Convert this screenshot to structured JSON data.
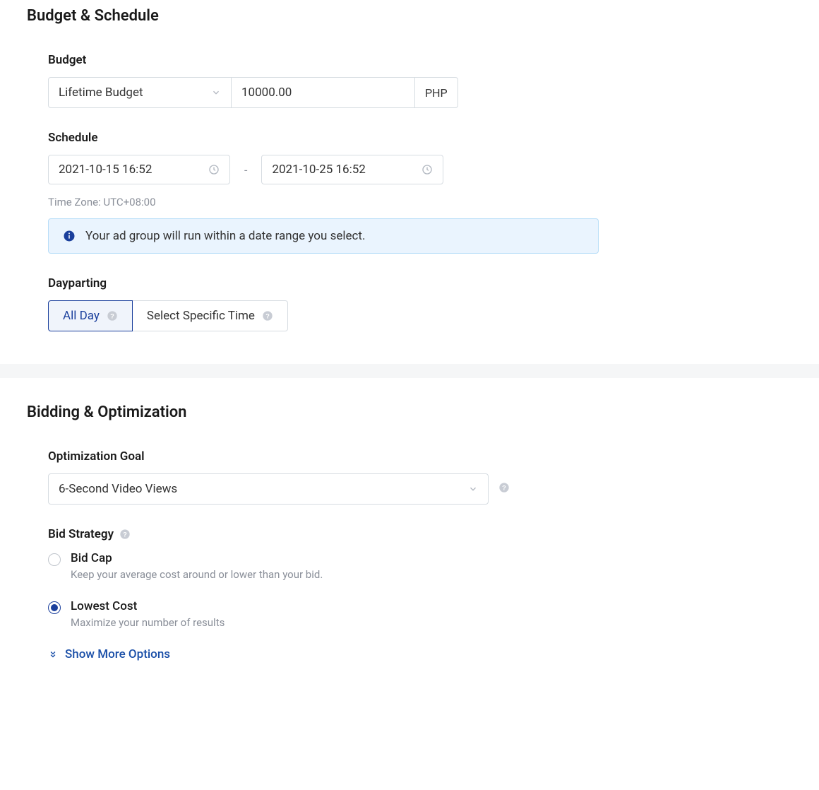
{
  "budget_schedule": {
    "title": "Budget & Schedule",
    "budget": {
      "label": "Budget",
      "type_value": "Lifetime Budget",
      "amount_value": "10000.00",
      "currency": "PHP"
    },
    "schedule": {
      "label": "Schedule",
      "start": "2021-10-15 16:52",
      "end": "2021-10-25 16:52",
      "timezone": "Time Zone: UTC+08:00",
      "info_text": "Your ad group will run within a date range you select."
    },
    "dayparting": {
      "label": "Dayparting",
      "option_all": "All Day",
      "option_specific": "Select Specific Time"
    }
  },
  "bidding": {
    "title": "Bidding & Optimization",
    "goal": {
      "label": "Optimization Goal",
      "value": "6-Second Video Views"
    },
    "strategy": {
      "label": "Bid Strategy",
      "bid_cap": {
        "title": "Bid Cap",
        "desc": "Keep your average cost around or lower than your bid."
      },
      "lowest_cost": {
        "title": "Lowest Cost",
        "desc": "Maximize your number of results"
      }
    },
    "show_more": "Show More Options"
  }
}
